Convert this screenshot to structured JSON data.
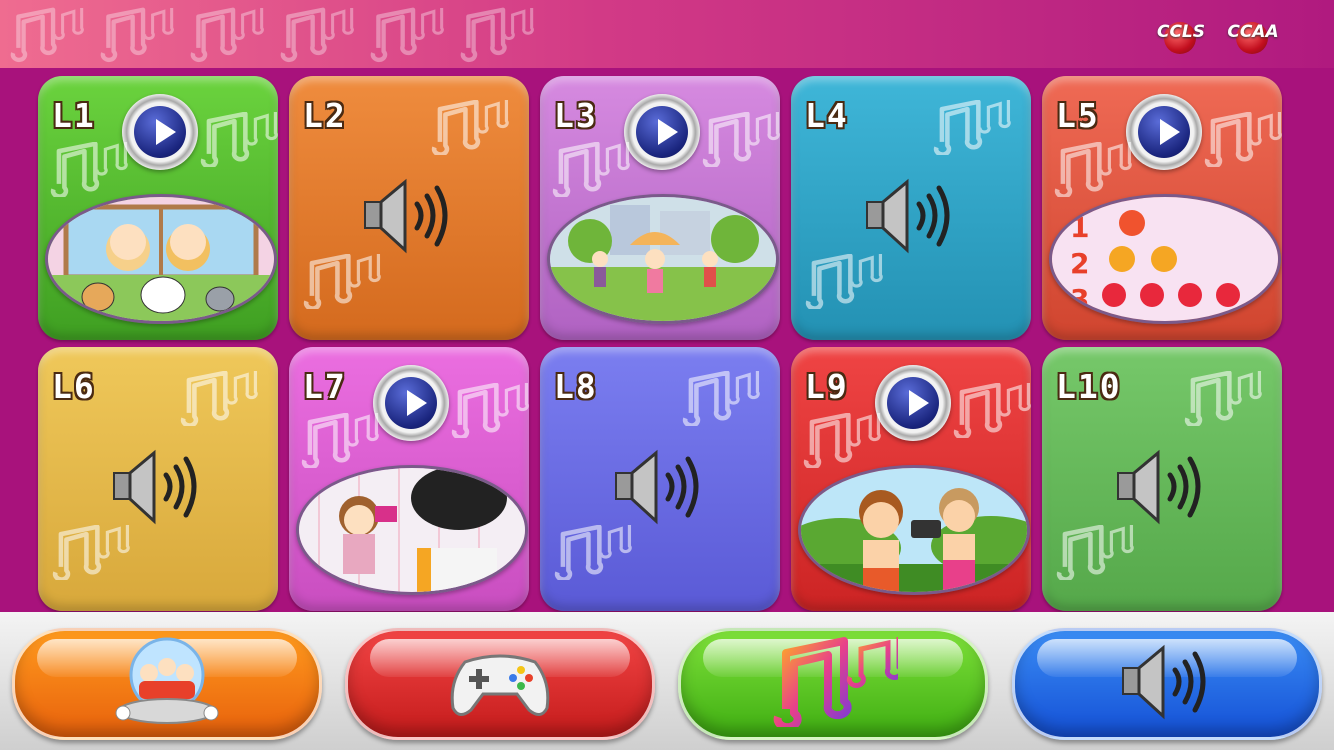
{
  "header": {
    "logos": [
      "CCLS",
      "CCAA"
    ]
  },
  "lessons": [
    {
      "label": "L1",
      "type": "video",
      "color": "#6bd33e",
      "dark": "#3f9f22",
      "scene": "family-window"
    },
    {
      "label": "L2",
      "type": "audio",
      "color": "#ef8c3e",
      "dark": "#d46a1e"
    },
    {
      "label": "L3",
      "type": "video",
      "color": "#d68ae0",
      "dark": "#b062c2",
      "scene": "rain-park"
    },
    {
      "label": "L4",
      "type": "audio",
      "color": "#3fb6d8",
      "dark": "#2391b3"
    },
    {
      "label": "L5",
      "type": "video",
      "color": "#ef6a55",
      "dark": "#d0452f",
      "scene": "counting-apples"
    },
    {
      "label": "L6",
      "type": "audio",
      "color": "#efc85a",
      "dark": "#d8a83b"
    },
    {
      "label": "L7",
      "type": "video",
      "color": "#eb6ee0",
      "dark": "#c94ec0",
      "scene": "kids-camera"
    },
    {
      "label": "L8",
      "type": "audio",
      "color": "#7b7ef0",
      "dark": "#5a5ad6"
    },
    {
      "label": "L9",
      "type": "video",
      "color": "#ef4444",
      "dark": "#cc2424",
      "scene": "kids-photo"
    },
    {
      "label": "L10",
      "type": "audio",
      "color": "#76c86a",
      "dark": "#55a84a"
    }
  ],
  "bottom_buttons": [
    {
      "name": "home-button",
      "icon": "kids-globe-icon",
      "color": "#ff9a1e",
      "dark": "#e8610c"
    },
    {
      "name": "games-button",
      "icon": "gamepad-icon",
      "color": "#f24545",
      "dark": "#c41b1b"
    },
    {
      "name": "music-button",
      "icon": "music-note-icon",
      "color": "#7ee03a",
      "dark": "#3fae12"
    },
    {
      "name": "sound-button",
      "icon": "speaker-icon",
      "color": "#3a8cf4",
      "dark": "#1450d6"
    }
  ]
}
